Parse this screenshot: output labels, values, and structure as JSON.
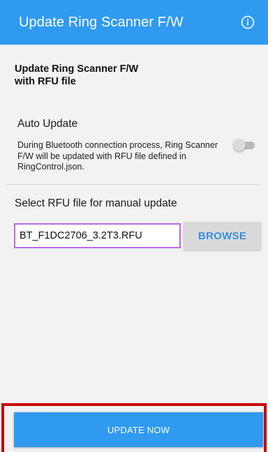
{
  "app_bar": {
    "title": "Update Ring Scanner F/W",
    "info_icon": "info-icon"
  },
  "heading": {
    "line1": "Update Ring Scanner F/W",
    "line2": "with RFU file"
  },
  "auto_update": {
    "label": "Auto Update",
    "description": "During Bluetooth connection process, Ring Scanner F/W will be updated with RFU file defined in RingControl.json.",
    "enabled": false
  },
  "manual": {
    "label": "Select RFU file for manual update",
    "file_value": "BT_F1DC2706_3.2T3.RFU",
    "browse_label": "BROWSE"
  },
  "footer": {
    "update_label": "UPDATE NOW"
  },
  "colors": {
    "primary": "#2f9af0",
    "field_focus": "#b86ae0",
    "highlight": "#c80000"
  }
}
